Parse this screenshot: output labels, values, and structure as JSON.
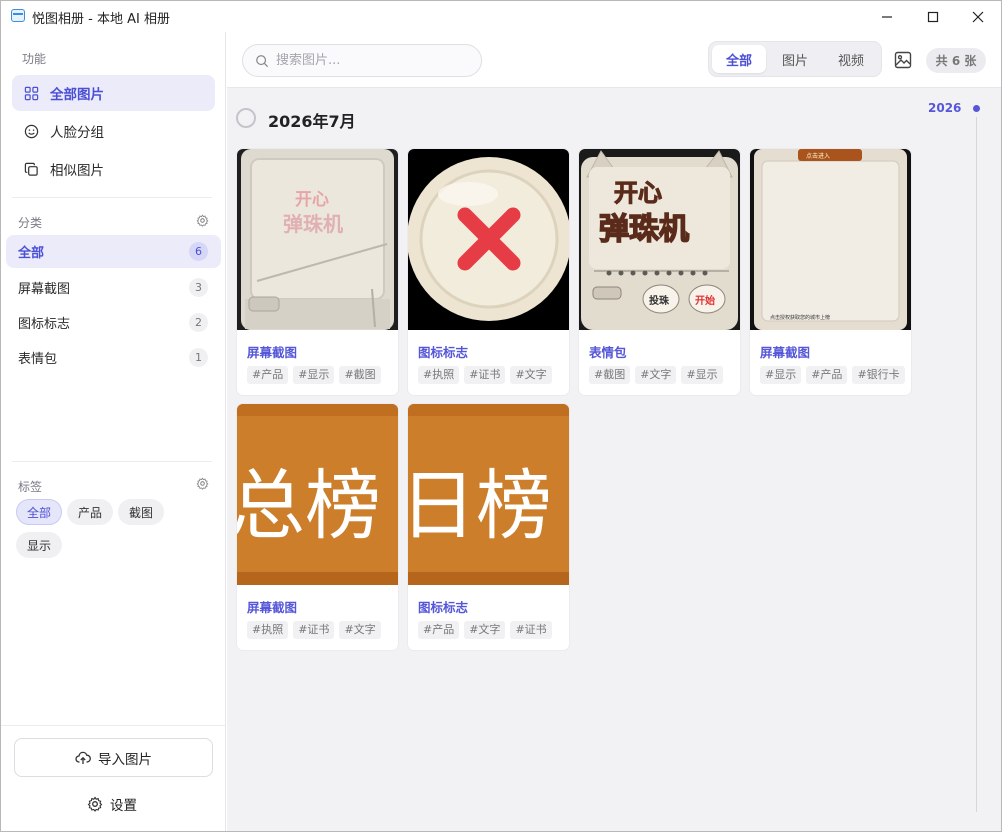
{
  "window": {
    "title": "悦图相册 - 本地 AI 相册"
  },
  "sidebar": {
    "features_title": "功能",
    "features": [
      {
        "label": "全部图片",
        "icon": "grid-icon",
        "active": true
      },
      {
        "label": "人脸分组",
        "icon": "smile-icon",
        "active": false
      },
      {
        "label": "相似图片",
        "icon": "copy-icon",
        "active": false
      }
    ],
    "categories_title": "分类",
    "categories": [
      {
        "label": "全部",
        "count": "6",
        "active": true
      },
      {
        "label": "屏幕截图",
        "count": "3",
        "active": false
      },
      {
        "label": "图标标志",
        "count": "2",
        "active": false
      },
      {
        "label": "表情包",
        "count": "1",
        "active": false
      }
    ],
    "tags_title": "标签",
    "tags": [
      {
        "label": "全部",
        "active": true
      },
      {
        "label": "产品",
        "active": false
      },
      {
        "label": "截图",
        "active": false
      },
      {
        "label": "显示",
        "active": false
      }
    ],
    "import_label": "导入图片",
    "settings_label": "设置"
  },
  "toolbar": {
    "search_placeholder": "搜索图片...",
    "filter_tabs": [
      "全部",
      "图片",
      "视频"
    ],
    "active_tab": "全部",
    "total_count": "共 6 张"
  },
  "gallery": {
    "month_title": "2026年7月",
    "cards": [
      {
        "title": "屏幕截图",
        "tags": [
          "#产品",
          "#显示",
          "#截图"
        ]
      },
      {
        "title": "图标标志",
        "tags": [
          "#执照",
          "#证书",
          "#文字"
        ]
      },
      {
        "title": "表情包",
        "tags": [
          "#截图",
          "#文字",
          "#显示"
        ]
      },
      {
        "title": "屏幕截图",
        "tags": [
          "#显示",
          "#产品",
          "#银行卡"
        ]
      },
      {
        "title": "屏幕截图",
        "tags": [
          "#执照",
          "#证书",
          "#文字"
        ]
      },
      {
        "title": "图标标志",
        "tags": [
          "#产品",
          "#文字",
          "#证书"
        ]
      }
    ],
    "thumb_text": {
      "pinball_line1": "开心",
      "pinball_line2": "弹珠机",
      "btn_left": "投珠",
      "btn_right": "开始",
      "phone_header": "点击进入",
      "phone_footer": "点击授权获取您的城市上榜",
      "banner_total": "总榜",
      "banner_daily": "日榜"
    }
  },
  "timeline": {
    "year": "2026"
  },
  "colors": {
    "accent": "#5557d8",
    "active_bg": "#ebebfa",
    "banner_orange": "#cc7e2a"
  }
}
